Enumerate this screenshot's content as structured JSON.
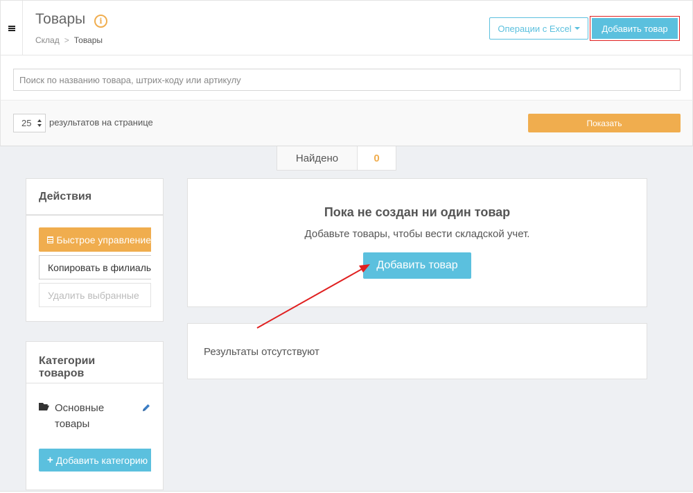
{
  "header": {
    "title": "Товары",
    "breadcrumb": {
      "parent": "Склад",
      "current": "Товары"
    },
    "excel_button": "Операции с Excel",
    "add_button": "Добавить товар"
  },
  "search": {
    "placeholder": "Поиск по названию товара, штрих-коду или артикулу"
  },
  "filters": {
    "per_page": "25",
    "per_page_label": "результатов на странице",
    "show_button": "Показать"
  },
  "found": {
    "label": "Найдено",
    "count": "0"
  },
  "actions": {
    "title": "Действия",
    "quick_button": "Быстрое управление",
    "copy_button": "Копировать в филиалы",
    "delete_button": "Удалить выбранные"
  },
  "categories": {
    "title": "Категории товаров",
    "items": [
      {
        "name": "Основные товары"
      }
    ],
    "add_button": "Добавить категорию"
  },
  "empty_state": {
    "title": "Пока не создан ни один товар",
    "subtitle": "Добавьте товары, чтобы вести складской учет.",
    "button": "Добавить товар"
  },
  "results": {
    "text": "Результаты отсутствуют"
  },
  "colors": {
    "accent_blue": "#5bc0de",
    "accent_orange": "#f0ad4e",
    "highlight_red": "#e02020"
  }
}
